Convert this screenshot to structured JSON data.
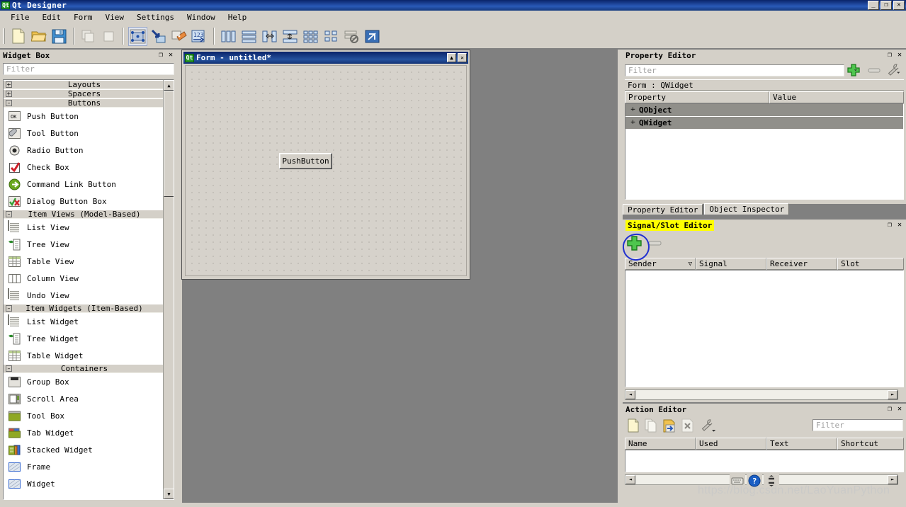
{
  "app": {
    "title": "Qt Designer",
    "icon": "qt-logo-icon",
    "window_buttons": {
      "minimize": "_",
      "restore": "❐",
      "close": "✕"
    }
  },
  "menubar": {
    "items": [
      {
        "label": "File"
      },
      {
        "label": "Edit"
      },
      {
        "label": "Form"
      },
      {
        "label": "View"
      },
      {
        "label": "Settings"
      },
      {
        "label": "Window"
      },
      {
        "label": "Help"
      }
    ]
  },
  "toolbar": {
    "groups": [
      {
        "buttons": [
          {
            "name": "new-form-icon",
            "label": "New"
          },
          {
            "name": "open-form-icon",
            "label": "Open"
          },
          {
            "name": "save-form-icon",
            "label": "Save"
          }
        ]
      },
      {
        "buttons": [
          {
            "name": "undo-icon",
            "label": "Undo"
          },
          {
            "name": "redo-icon",
            "label": "Redo"
          }
        ]
      },
      {
        "buttons": [
          {
            "name": "edit-widgets-icon",
            "label": "Edit Widgets",
            "selected": true
          },
          {
            "name": "edit-signals-slots-icon",
            "label": "Edit Signals/Slots"
          },
          {
            "name": "edit-buddies-icon",
            "label": "Edit Buddies"
          },
          {
            "name": "edit-tab-order-icon",
            "label": "Edit Tab Order"
          }
        ]
      },
      {
        "buttons": [
          {
            "name": "layout-horizontally-icon",
            "label": "Lay Out Horizontally"
          },
          {
            "name": "layout-vertically-icon",
            "label": "Lay Out Vertically"
          },
          {
            "name": "layout-splitter-horizontal-icon",
            "label": "Lay Out Horizontally in Splitter"
          },
          {
            "name": "layout-splitter-vertical-icon",
            "label": "Lay Out Vertically in Splitter"
          },
          {
            "name": "layout-grid-icon",
            "label": "Lay Out in a Grid"
          },
          {
            "name": "layout-form-icon",
            "label": "Lay Out in a Form Layout"
          },
          {
            "name": "break-layout-icon",
            "label": "Break Layout"
          },
          {
            "name": "adjust-size-icon",
            "label": "Adjust Size"
          }
        ]
      }
    ]
  },
  "widget_box": {
    "title": "Widget Box",
    "float_button": "❐",
    "close_button": "✕",
    "filter_placeholder": "Filter",
    "categories": [
      {
        "label": "Layouts",
        "expanded": false,
        "items": []
      },
      {
        "label": "Spacers",
        "expanded": false,
        "items": []
      },
      {
        "label": "Buttons",
        "expanded": true,
        "items": [
          {
            "label": "Push Button",
            "icon": "push-button-icon"
          },
          {
            "label": "Tool Button",
            "icon": "tool-button-icon"
          },
          {
            "label": "Radio Button",
            "icon": "radio-button-icon"
          },
          {
            "label": "Check Box",
            "icon": "check-box-icon"
          },
          {
            "label": "Command Link Button",
            "icon": "command-link-button-icon"
          },
          {
            "label": "Dialog Button Box",
            "icon": "dialog-button-box-icon"
          }
        ]
      },
      {
        "label": "Item Views (Model-Based)",
        "expanded": true,
        "items": [
          {
            "label": "List View",
            "icon": "list-view-icon"
          },
          {
            "label": "Tree View",
            "icon": "tree-view-icon"
          },
          {
            "label": "Table View",
            "icon": "table-view-icon"
          },
          {
            "label": "Column View",
            "icon": "column-view-icon"
          },
          {
            "label": "Undo View",
            "icon": "undo-view-icon"
          }
        ]
      },
      {
        "label": "Item Widgets (Item-Based)",
        "expanded": true,
        "items": [
          {
            "label": "List Widget",
            "icon": "list-widget-icon"
          },
          {
            "label": "Tree Widget",
            "icon": "tree-widget-icon"
          },
          {
            "label": "Table Widget",
            "icon": "table-widget-icon"
          }
        ]
      },
      {
        "label": "Containers",
        "expanded": true,
        "items": [
          {
            "label": "Group Box",
            "icon": "group-box-icon"
          },
          {
            "label": "Scroll Area",
            "icon": "scroll-area-icon"
          },
          {
            "label": "Tool Box",
            "icon": "tool-box-icon"
          },
          {
            "label": "Tab Widget",
            "icon": "tab-widget-icon"
          },
          {
            "label": "Stacked Widget",
            "icon": "stacked-widget-icon"
          },
          {
            "label": "Frame",
            "icon": "frame-icon"
          },
          {
            "label": "Widget",
            "icon": "widget-icon"
          }
        ]
      }
    ]
  },
  "form_window": {
    "title": "Form - untitled*",
    "icon": "qt-form-icon",
    "buttons": {
      "maximize": "▲",
      "close": "✕"
    },
    "widgets": [
      {
        "type": "PushButton",
        "label": "PushButton"
      }
    ]
  },
  "property_editor": {
    "title": "Property Editor",
    "float_button": "❐",
    "close_button": "✕",
    "filter_placeholder": "Filter",
    "add_button": "+",
    "remove_button": "–",
    "configure_button": "configure-icon",
    "object_line": "Form : QWidget",
    "columns": [
      "Property",
      "Value"
    ],
    "rows": [
      {
        "expander": "+",
        "property": "QObject",
        "value": ""
      },
      {
        "expander": "+",
        "property": "QWidget",
        "value": ""
      }
    ]
  },
  "dock_tabs": {
    "items": [
      {
        "label": "Property Editor",
        "active": false
      },
      {
        "label": "Object Inspector",
        "active": true
      }
    ]
  },
  "signal_slot_editor": {
    "title": "Signal/Slot Editor",
    "highlighted": true,
    "float_button": "❐",
    "close_button": "✕",
    "add_button": "+",
    "remove_button": "–",
    "columns": [
      "Sender",
      "Signal",
      "Receiver",
      "Slot"
    ],
    "sort_indicator": "▽",
    "rows": [],
    "hscroll": {
      "left": "◄",
      "right": "►"
    }
  },
  "action_editor": {
    "title": "Action Editor",
    "float_button": "❐",
    "close_button": "✕",
    "filter_placeholder": "Filter",
    "tools": [
      {
        "name": "new-action-icon",
        "label": "New"
      },
      {
        "name": "copy-action-icon",
        "label": "Copy"
      },
      {
        "name": "paste-action-icon",
        "label": "Paste"
      },
      {
        "name": "delete-action-icon",
        "label": "Delete"
      },
      {
        "name": "edit-action-icon",
        "label": "Edit"
      }
    ],
    "columns": [
      "Name",
      "Used",
      "Text",
      "Shortcut"
    ],
    "rows": [],
    "hscroll": {
      "left": "◄",
      "right": "►"
    }
  },
  "status_buttons": [
    {
      "name": "keyboard-icon"
    },
    {
      "name": "help-icon"
    },
    {
      "name": "spinner-icon"
    }
  ],
  "annotations": {
    "watermark": "https://blog.csdn.net/LaoYuanPython",
    "blue_circle": "highlight-add-signal-slot-button",
    "yellow_highlight": "Signal/Slot Editor"
  },
  "colors": {
    "window_face": "#d4d0c8",
    "titlebar_start": "#0a246a",
    "titlebar_end": "#2a5ab8",
    "mdi_background": "#808080",
    "accent_green": "#3cb33c",
    "highlight_yellow": "#ffff00",
    "annotation_blue": "#2030d0",
    "row_header_gray": "#908f8a"
  }
}
